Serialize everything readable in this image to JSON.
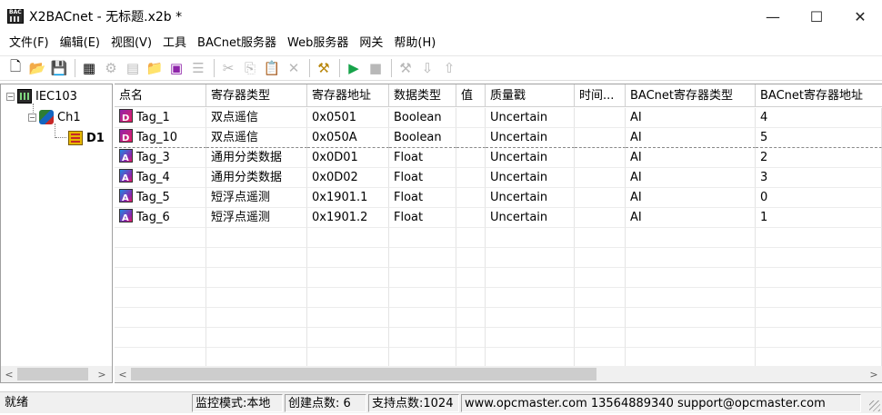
{
  "window": {
    "title": "X2BACnet - 无标题.x2b *",
    "minimize": "—",
    "maximize": "☐",
    "close": "✕"
  },
  "menu": [
    "文件(F)",
    "编辑(E)",
    "视图(V)",
    "工具",
    "BACnet服务器",
    "Web服务器",
    "网关",
    "帮助(H)"
  ],
  "toolbar": {
    "icons": [
      "new-file-icon",
      "open-folder-icon",
      "save-icon",
      "device-icon",
      "channel-icon",
      "table-icon",
      "add-folder-icon",
      "add-tag-icon",
      "properties-icon",
      "cut-icon",
      "copy-icon",
      "paste-icon",
      "delete-icon",
      "tool-icon",
      "run-icon",
      "stop-icon",
      "tools-icon",
      "load-icon",
      "unload-icon"
    ]
  },
  "tree": {
    "root": {
      "label": "IEC103",
      "expander": "⊟"
    },
    "channel": {
      "label": "Ch1",
      "expander": "⊟"
    },
    "device": {
      "label": "D1"
    }
  },
  "grid": {
    "columns": [
      "点名",
      "寄存器类型",
      "寄存器地址",
      "数据类型",
      "值",
      "质量戳",
      "时间...",
      "BACnet寄存器类型",
      "BACnet寄存器地址"
    ],
    "rows": [
      {
        "icon": "di",
        "name": "Tag_1",
        "reg_type": "双点遥信",
        "address": "0x0501",
        "data_type": "Boolean",
        "value": "",
        "quality": "Uncertain",
        "time": "",
        "bac_type": "AI",
        "bac_addr": "4"
      },
      {
        "icon": "di",
        "name": "Tag_10",
        "reg_type": "双点遥信",
        "address": "0x050A",
        "data_type": "Boolean",
        "value": "",
        "quality": "Uncertain",
        "time": "",
        "bac_type": "AI",
        "bac_addr": "5"
      },
      {
        "icon": "ai",
        "name": "Tag_3",
        "reg_type": "通用分类数据",
        "address": "0x0D01",
        "data_type": "Float",
        "value": "",
        "quality": "Uncertain",
        "time": "",
        "bac_type": "AI",
        "bac_addr": "2"
      },
      {
        "icon": "ai",
        "name": "Tag_4",
        "reg_type": "通用分类数据",
        "address": "0x0D02",
        "data_type": "Float",
        "value": "",
        "quality": "Uncertain",
        "time": "",
        "bac_type": "AI",
        "bac_addr": "3"
      },
      {
        "icon": "ai",
        "name": "Tag_5",
        "reg_type": "短浮点遥测",
        "address": "0x1901.1",
        "data_type": "Float",
        "value": "",
        "quality": "Uncertain",
        "time": "",
        "bac_type": "AI",
        "bac_addr": "0"
      },
      {
        "icon": "ai",
        "name": "Tag_6",
        "reg_type": "短浮点遥测",
        "address": "0x1901.2",
        "data_type": "Float",
        "value": "",
        "quality": "Uncertain",
        "time": "",
        "bac_type": "AI",
        "bac_addr": "1"
      }
    ]
  },
  "status": {
    "ready": "就绪",
    "mode": "监控模式:本地",
    "created": "创建点数: 6",
    "supported": "支持点数:1024",
    "contact": "www.opcmaster.com 13564889340 support@opcmaster.com"
  },
  "scroll": {
    "left": "<",
    "right": ">"
  }
}
